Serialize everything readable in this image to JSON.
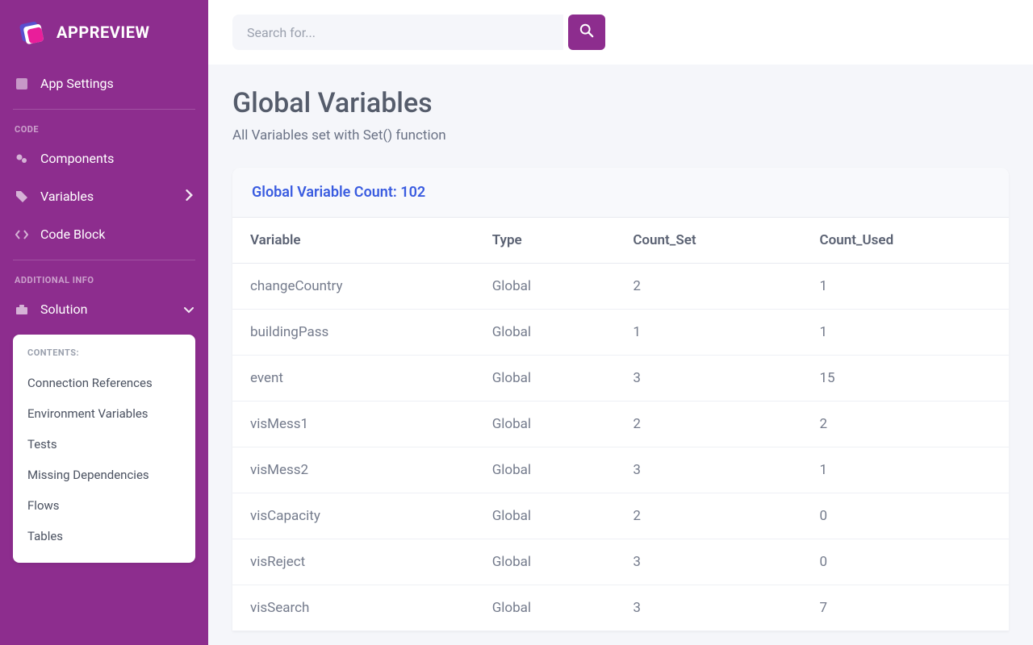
{
  "brand": {
    "name": "APPREVIEW"
  },
  "search": {
    "placeholder": "Search for..."
  },
  "sidebar": {
    "app_settings": "App Settings",
    "section_code": "CODE",
    "components": "Components",
    "variables": "Variables",
    "code_block": "Code Block",
    "section_additional": "ADDITIONAL INFO",
    "solution": "Solution",
    "submenu_heading": "CONTENTS:",
    "submenu": [
      "Connection References",
      "Environment Variables",
      "Tests",
      "Missing Dependencies",
      "Flows",
      "Tables"
    ]
  },
  "page": {
    "title": "Global Variables",
    "subtitle": "All Variables set with Set() function",
    "count_label": "Global Variable Count: 102"
  },
  "table": {
    "headers": {
      "variable": "Variable",
      "type": "Type",
      "count_set": "Count_Set",
      "count_used": "Count_Used"
    },
    "rows": [
      {
        "variable": "changeCountry",
        "type": "Global",
        "count_set": "2",
        "count_used": "1"
      },
      {
        "variable": "buildingPass",
        "type": "Global",
        "count_set": "1",
        "count_used": "1"
      },
      {
        "variable": "event",
        "type": "Global",
        "count_set": "3",
        "count_used": "15"
      },
      {
        "variable": "visMess1",
        "type": "Global",
        "count_set": "2",
        "count_used": "2"
      },
      {
        "variable": "visMess2",
        "type": "Global",
        "count_set": "3",
        "count_used": "1"
      },
      {
        "variable": "visCapacity",
        "type": "Global",
        "count_set": "2",
        "count_used": "0"
      },
      {
        "variable": "visReject",
        "type": "Global",
        "count_set": "3",
        "count_used": "0"
      },
      {
        "variable": "visSearch",
        "type": "Global",
        "count_set": "3",
        "count_used": "7"
      }
    ]
  }
}
